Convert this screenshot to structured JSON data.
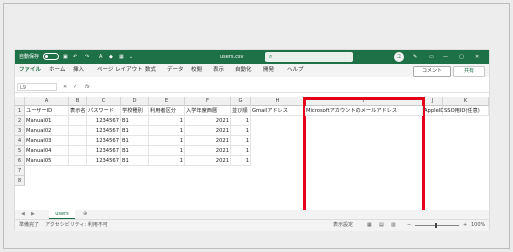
{
  "titlebar": {
    "autosave": "自動保存",
    "toggle": "オフ",
    "filename": "users.csv",
    "user_initial": "ユ",
    "window_min": "—",
    "window_max": "▢",
    "window_close": "✕"
  },
  "menu": {
    "items": [
      "ファイル",
      "ホーム",
      "挿入",
      "ページ レイアウト",
      "数式",
      "データ",
      "校閲",
      "表示",
      "自動化",
      "開発",
      "ヘルプ"
    ],
    "comment_label": "コメント",
    "share_label": "共有"
  },
  "formula": {
    "namebox": "L9",
    "fx": "fx"
  },
  "columns": [
    "A",
    "B",
    "C",
    "D",
    "E",
    "F",
    "G",
    "H",
    "I",
    "J",
    "K"
  ],
  "header_row": [
    "ユーザーID",
    "表示名",
    "パスワード",
    "学校種別",
    "利用者区分",
    "入学年度西暦",
    "並び順",
    "Gmailアドレス",
    "Microsoftアカウントのメールアドレス",
    "AppleID",
    "SSO用ID(任意)"
  ],
  "rows": [
    [
      "Manual01",
      "",
      "1234567",
      "B1",
      "1",
      "2021",
      "1"
    ],
    [
      "Manual02",
      "",
      "1234567",
      "B1",
      "1",
      "2021",
      "1"
    ],
    [
      "Manual03",
      "",
      "1234567",
      "B1",
      "1",
      "2021",
      "1"
    ],
    [
      "Manual04",
      "",
      "1234567",
      "B1",
      "1",
      "2021",
      "1"
    ],
    [
      "Manual05",
      "",
      "1234567",
      "B1",
      "1",
      "2021",
      "1"
    ]
  ],
  "row_numbers": [
    "1",
    "2",
    "3",
    "4",
    "5",
    "6",
    "7",
    "8"
  ],
  "sheet_tab": "users",
  "status": {
    "ready": "準備完了",
    "accessibility": "アクセシビリティ: 利用不可",
    "display_settings": "表示設定",
    "zoom": "100%"
  }
}
